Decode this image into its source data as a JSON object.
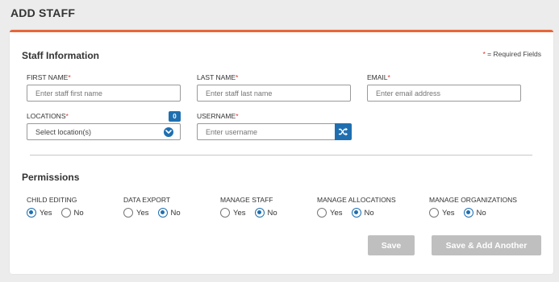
{
  "page": {
    "title": "ADD STAFF"
  },
  "staff_info": {
    "title": "Staff Information",
    "required_note_star": "*",
    "required_note": " = Required Fields",
    "first_name": {
      "label": "FIRST NAME",
      "required": "*",
      "placeholder": "Enter staff first name",
      "value": ""
    },
    "last_name": {
      "label": "LAST NAME",
      "required": "*",
      "placeholder": "Enter staff last name",
      "value": ""
    },
    "email": {
      "label": "EMAIL",
      "required": "*",
      "placeholder": "Enter email address",
      "value": ""
    },
    "locations": {
      "label": "LOCATIONS",
      "required": "*",
      "placeholder": "Select location(s)",
      "count": "0"
    },
    "username": {
      "label": "USERNAME",
      "required": "*",
      "placeholder": "Enter username",
      "value": ""
    }
  },
  "permissions": {
    "title": "Permissions",
    "yes_label": "Yes",
    "no_label": "No",
    "items": [
      {
        "label": "CHILD EDITING",
        "selected": "Yes"
      },
      {
        "label": "DATA EXPORT",
        "selected": "No"
      },
      {
        "label": "MANAGE STAFF",
        "selected": "No"
      },
      {
        "label": "MANAGE ALLOCATIONS",
        "selected": "No"
      },
      {
        "label": "MANAGE ORGANIZATIONS",
        "selected": "No"
      }
    ]
  },
  "actions": {
    "save": "Save",
    "save_add_another": "Save & Add Another"
  },
  "colors": {
    "accent": "#e8663a",
    "primary": "#1f6fb0",
    "required": "#d9342b",
    "disabled_button": "#bfbfbf"
  }
}
